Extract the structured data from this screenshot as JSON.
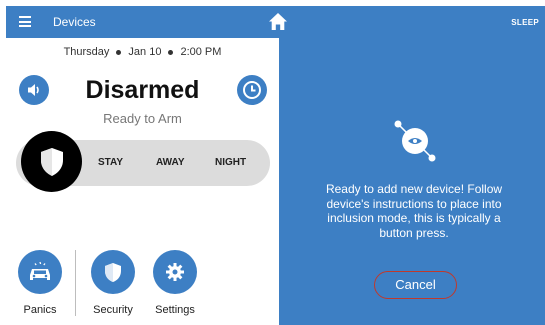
{
  "topbar": {
    "title": "Devices",
    "sleep_label": "SLEEP",
    "menu_icon": "hamburger-icon",
    "home_icon": "home-icon",
    "sleep_icon": "moon-icon"
  },
  "left": {
    "date": {
      "day": "Thursday",
      "date": "Jan 10",
      "time": "2:00 PM"
    },
    "status": "Disarmed",
    "substatus": "Ready to Arm",
    "modes": {
      "stay": "STAY",
      "away": "AWAY",
      "night": "NIGHT"
    },
    "bottom": {
      "panics": "Panics",
      "security": "Security",
      "settings": "Settings"
    }
  },
  "right": {
    "message": "Ready to add new device! Follow device's instructions to place into inclusion mode, this is typically a button press.",
    "cancel_label": "Cancel"
  },
  "colors": {
    "accent": "#3d7fc4",
    "cancel_border": "#c0392b",
    "track": "#dcdcdc"
  }
}
